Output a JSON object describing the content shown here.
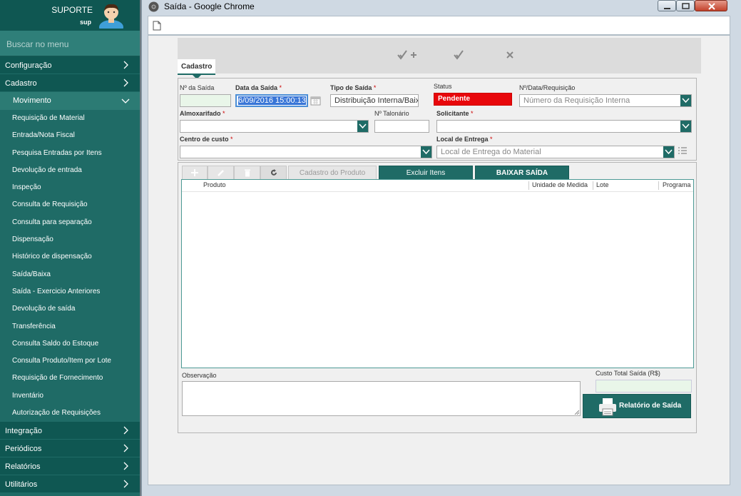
{
  "user": {
    "name": "SUPORTE",
    "login": "sup"
  },
  "search": {
    "placeholder": "Buscar no menu"
  },
  "menu": {
    "configuracao": "Configuração",
    "cadastro": "Cadastro",
    "movimento": "Movimento",
    "submenu": [
      "Requisição de Material",
      "Entrada/Nota Fiscal",
      "Pesquisa Entradas por Itens",
      "Devolução de entrada",
      "Inspeção",
      "Consulta de Requisição",
      "Consulta para separação",
      "Dispensação",
      "Histórico de dispensação",
      "Saída/Baixa",
      "Saída - Exercicio Anteriores",
      "Devolução de saída",
      "Transferência",
      "Consulta Saldo do Estoque",
      "Consulta Produto/Item por Lote",
      "Requisição de Fornecimento",
      "Inventário",
      "Autorização de Requisições"
    ],
    "integracao": "Integração",
    "periodicos": "Periódicos",
    "relatorios": "Relatórios",
    "utilitarios": "Utilitários"
  },
  "window": {
    "title": "Saída - Google Chrome"
  },
  "tab": {
    "label": "Cadastro"
  },
  "form": {
    "num_saida_label": "Nº da Saída",
    "num_saida_value": "",
    "data_saida_label": "Data da Saída",
    "data_saida_value": "6/09/2016 15:00:13",
    "tipo_saida_label": "Tipo de Saída",
    "tipo_saida_value": "Distribuição Interna/Baixa",
    "status_label": "Status",
    "status_value": "Pendente",
    "requisicao_label": "Nº/Data/Requisição",
    "requisicao_placeholder": "Número da Requisição Interna",
    "almoxarifado_label": "Almoxarifado",
    "talonario_label": "Nº Talonário",
    "solicitante_label": "Solicitante",
    "centro_custo_label": "Centro de custo",
    "local_entrega_label": "Local de Entrega",
    "local_entrega_placeholder": "Local de Entrega do Material",
    "required_mark": "*"
  },
  "grid": {
    "buttons": {
      "cadastro_produto": "Cadastro do Produto",
      "excluir_itens": "Excluir Itens",
      "baixar_saida": "BAIXAR SAÍDA"
    },
    "columns": [
      "Produto",
      "Unidade de Medida",
      "Lote",
      "Programa"
    ]
  },
  "bottom": {
    "observacao_label": "Observação",
    "custo_total_label": "Custo Total Saída (R$)",
    "relatorio_button": "Relatório de Saída"
  },
  "colors": {
    "teal": "#1f6b66",
    "status_red": "#e8070b",
    "green_field": "#e9f6e9"
  }
}
